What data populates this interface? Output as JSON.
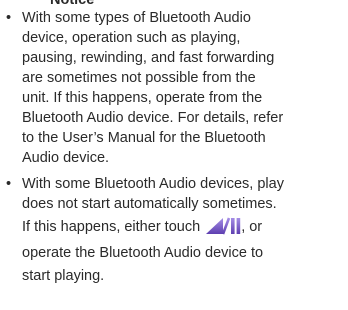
{
  "notice": {
    "heading": "Notice",
    "bullet_symbol": "•",
    "bullets": [
      {
        "lines": [
          "With some types of Bluetooth Audio",
          "device, operation such as playing,",
          "pausing, rewinding, and fast forwarding",
          "are sometimes not possible from the",
          "unit. If this happens, operate from the",
          "Bluetooth Audio device. For details, refer",
          "to the User’s Manual for the Bluetooth",
          "Audio device."
        ]
      },
      {
        "lines": [
          "With some Bluetooth Audio devices, play",
          "does not start automatically sometimes."
        ],
        "icon_line_before": "If this happens, either touch",
        "icon_name": "play-pause-icon",
        "icon_color": "#7b5cc4",
        "icon_line_after": ", or",
        "trailing_lines": [
          "operate the Bluetooth Audio device to",
          "start playing."
        ]
      }
    ]
  }
}
